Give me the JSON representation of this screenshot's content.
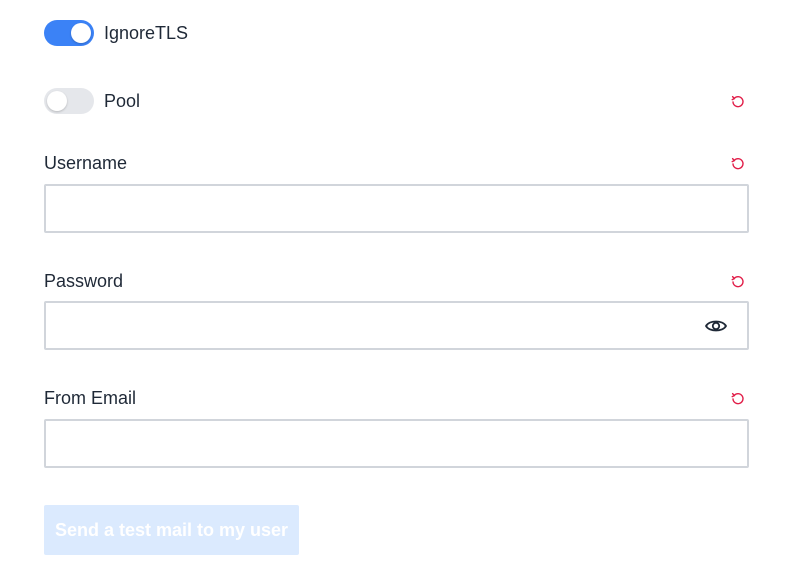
{
  "toggles": {
    "ignore_tls": {
      "label": "IgnoreTLS",
      "on": true
    },
    "pool": {
      "label": "Pool",
      "on": false
    }
  },
  "fields": {
    "username": {
      "label": "Username",
      "value": ""
    },
    "password": {
      "label": "Password",
      "value": ""
    },
    "from_email": {
      "label": "From Email",
      "value": ""
    }
  },
  "send_button": {
    "label": "Send a test mail to my user",
    "disabled": true
  },
  "icons": {
    "reset": "reset-icon",
    "eye": "eye-icon"
  },
  "colors": {
    "accent": "#3b82f6",
    "reset": "#e11d48",
    "button_disabled_bg": "#dbeafe"
  }
}
